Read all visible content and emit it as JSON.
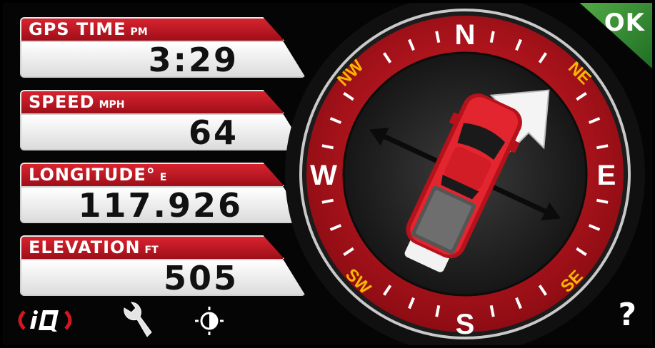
{
  "panels": [
    {
      "label": "GPS TIME",
      "unit": "PM",
      "value": "3:29"
    },
    {
      "label": "SPEED",
      "unit": "MPH",
      "value": "64"
    },
    {
      "label": "LONGITUDE°",
      "unit": "E",
      "value": "117.926"
    },
    {
      "label": "ELEVATION",
      "unit": "FT",
      "value": "505"
    }
  ],
  "ok_button": "OK",
  "help_button": "?",
  "compass": {
    "cardinal": {
      "n": "N",
      "e": "E",
      "s": "S",
      "w": "W"
    },
    "intercardinal": {
      "ne": "NE",
      "se": "SE",
      "sw": "SW",
      "nw": "NW"
    },
    "arrow_heading_deg": 45,
    "vehicle_heading_deg": 25
  },
  "icons": {
    "logo": "iq-logo-icon",
    "settings": "wrench-icon",
    "brightness": "brightness-icon"
  },
  "colors": {
    "red": "#c8161f",
    "ok_green": "#2e8a32",
    "intercardinal_text": "#f5b800"
  }
}
